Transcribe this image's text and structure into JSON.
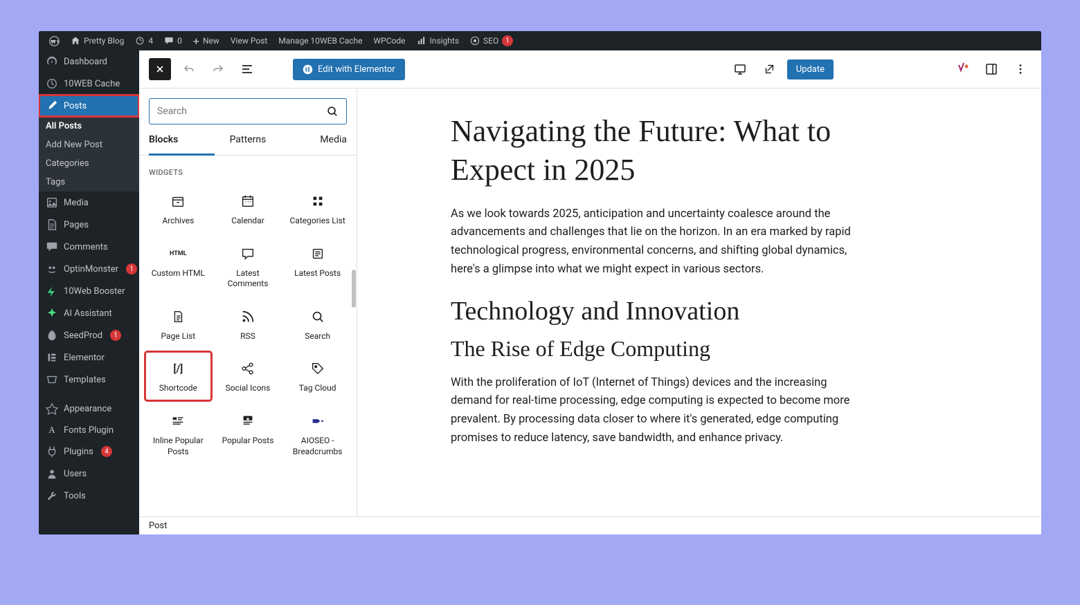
{
  "adminbar": {
    "site_name": "Pretty Blog",
    "refresh_count": "4",
    "comments_count": "0",
    "new_label": "New",
    "items": [
      "View Post",
      "Manage 10WEB Cache",
      "WPCode",
      "Insights",
      "SEO"
    ],
    "seo_badge": "1"
  },
  "sidebar": {
    "dashboard": "Dashboard",
    "tenweb_cache": "10WEB Cache",
    "posts": "Posts",
    "posts_sub": [
      "All Posts",
      "Add New Post",
      "Categories",
      "Tags"
    ],
    "media": "Media",
    "pages": "Pages",
    "comments": "Comments",
    "optinmonster": "OptinMonster",
    "optinmonster_badge": "1",
    "booster": "10Web Booster",
    "ai_assistant": "AI Assistant",
    "seedprod": "SeedProd",
    "seedprod_badge": "1",
    "elementor": "Elementor",
    "templates": "Templates",
    "appearance": "Appearance",
    "fonts_plugin": "Fonts Plugin",
    "plugins": "Plugins",
    "plugins_badge": "4",
    "users": "Users",
    "tools": "Tools"
  },
  "topbar": {
    "elementor_label": "Edit with Elementor",
    "update_label": "Update"
  },
  "inserter": {
    "search_placeholder": "Search",
    "tabs": [
      "Blocks",
      "Patterns",
      "Media"
    ],
    "section": "WIDGETS",
    "blocks": [
      "Archives",
      "Calendar",
      "Categories List",
      "Custom HTML",
      "Latest Comments",
      "Latest Posts",
      "Page List",
      "RSS",
      "Search",
      "Shortcode",
      "Social Icons",
      "Tag Cloud",
      "Inline Popular Posts",
      "Popular Posts",
      "AIOSEO - Breadcrumbs"
    ]
  },
  "content": {
    "title": "Navigating the Future: What to Expect in 2025",
    "p1": "As we look towards 2025, anticipation and uncertainty coalesce around the advancements and challenges that lie on the horizon. In an era marked by rapid technological progress, environmental concerns, and shifting global dynamics, here's a glimpse into what we might expect in various sectors.",
    "h2": "Technology and Innovation",
    "h3": "The Rise of Edge Computing",
    "p2": "With the proliferation of IoT (Internet of Things) devices and the increasing demand for real-time processing, edge computing is expected to become more prevalent. By processing data closer to where it's generated, edge computing promises to reduce latency, save bandwidth, and enhance privacy."
  },
  "breadcrumb": "Post"
}
